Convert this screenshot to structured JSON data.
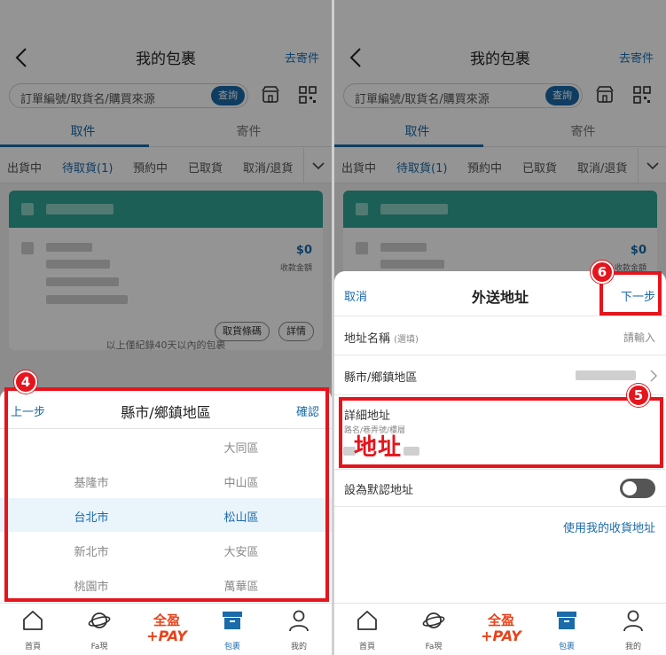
{
  "header": {
    "title": "我的包裹",
    "send_link": "去寄件",
    "search_placeholder": "訂單編號/取貨名/購買來源",
    "query_btn": "查詢"
  },
  "tabs": [
    {
      "label": "取件",
      "active": true
    },
    {
      "label": "寄件",
      "active": false
    }
  ],
  "filters": [
    {
      "label": "出貨中",
      "active": false
    },
    {
      "label": "待取貨(1)",
      "active": true
    },
    {
      "label": "預約中",
      "active": false
    },
    {
      "label": "已取貨",
      "active": false
    },
    {
      "label": "取消/退貨",
      "active": false
    }
  ],
  "card": {
    "amount": "$0",
    "amount_label": "收款金額",
    "pickup_code_btn": "取貨條碼",
    "detail_btn": "詳情"
  },
  "list_note": "以上僅紀錄40天以內的包裹",
  "picker": {
    "prev": "上一步",
    "title": "縣市/鄉鎮地區",
    "confirm": "確認",
    "cities": [
      "",
      "基隆市",
      "台北市",
      "新北市",
      "桃園市"
    ],
    "districts": [
      "大同區",
      "中山區",
      "松山區",
      "大安區",
      "萬華區"
    ],
    "selected_city": "台北市",
    "selected_district": "松山區"
  },
  "form": {
    "cancel": "取消",
    "title": "外送地址",
    "next": "下一步",
    "addr_name_label": "地址名稱",
    "addr_name_sub": "(選填)",
    "addr_name_placeholder": "請輸入",
    "region_label": "縣市/鄉鎮地區",
    "detail_label": "詳細地址",
    "detail_hint": "路名/巷弄號/樓層",
    "detail_value": "地址",
    "default_label": "設為默認地址",
    "default_on": false,
    "use_my_address": "使用我的收貨地址"
  },
  "nav": [
    {
      "label": "首頁",
      "icon": "home-icon",
      "active": false
    },
    {
      "label": "Fa現",
      "icon": "planet-icon",
      "active": false
    },
    {
      "label": "",
      "icon": "pay-logo",
      "active": false
    },
    {
      "label": "包裹",
      "icon": "package-box-icon",
      "active": true
    },
    {
      "label": "我的",
      "icon": "user-icon",
      "active": false
    }
  ],
  "pay_logo": {
    "line1": "全盈",
    "line2": "+PAY"
  },
  "annotations": {
    "step4": "4",
    "step5": "5",
    "step6": "6"
  },
  "colors": {
    "accent": "#1b6aa9",
    "teal": "#2fa495",
    "annotation": "#e6141c"
  }
}
